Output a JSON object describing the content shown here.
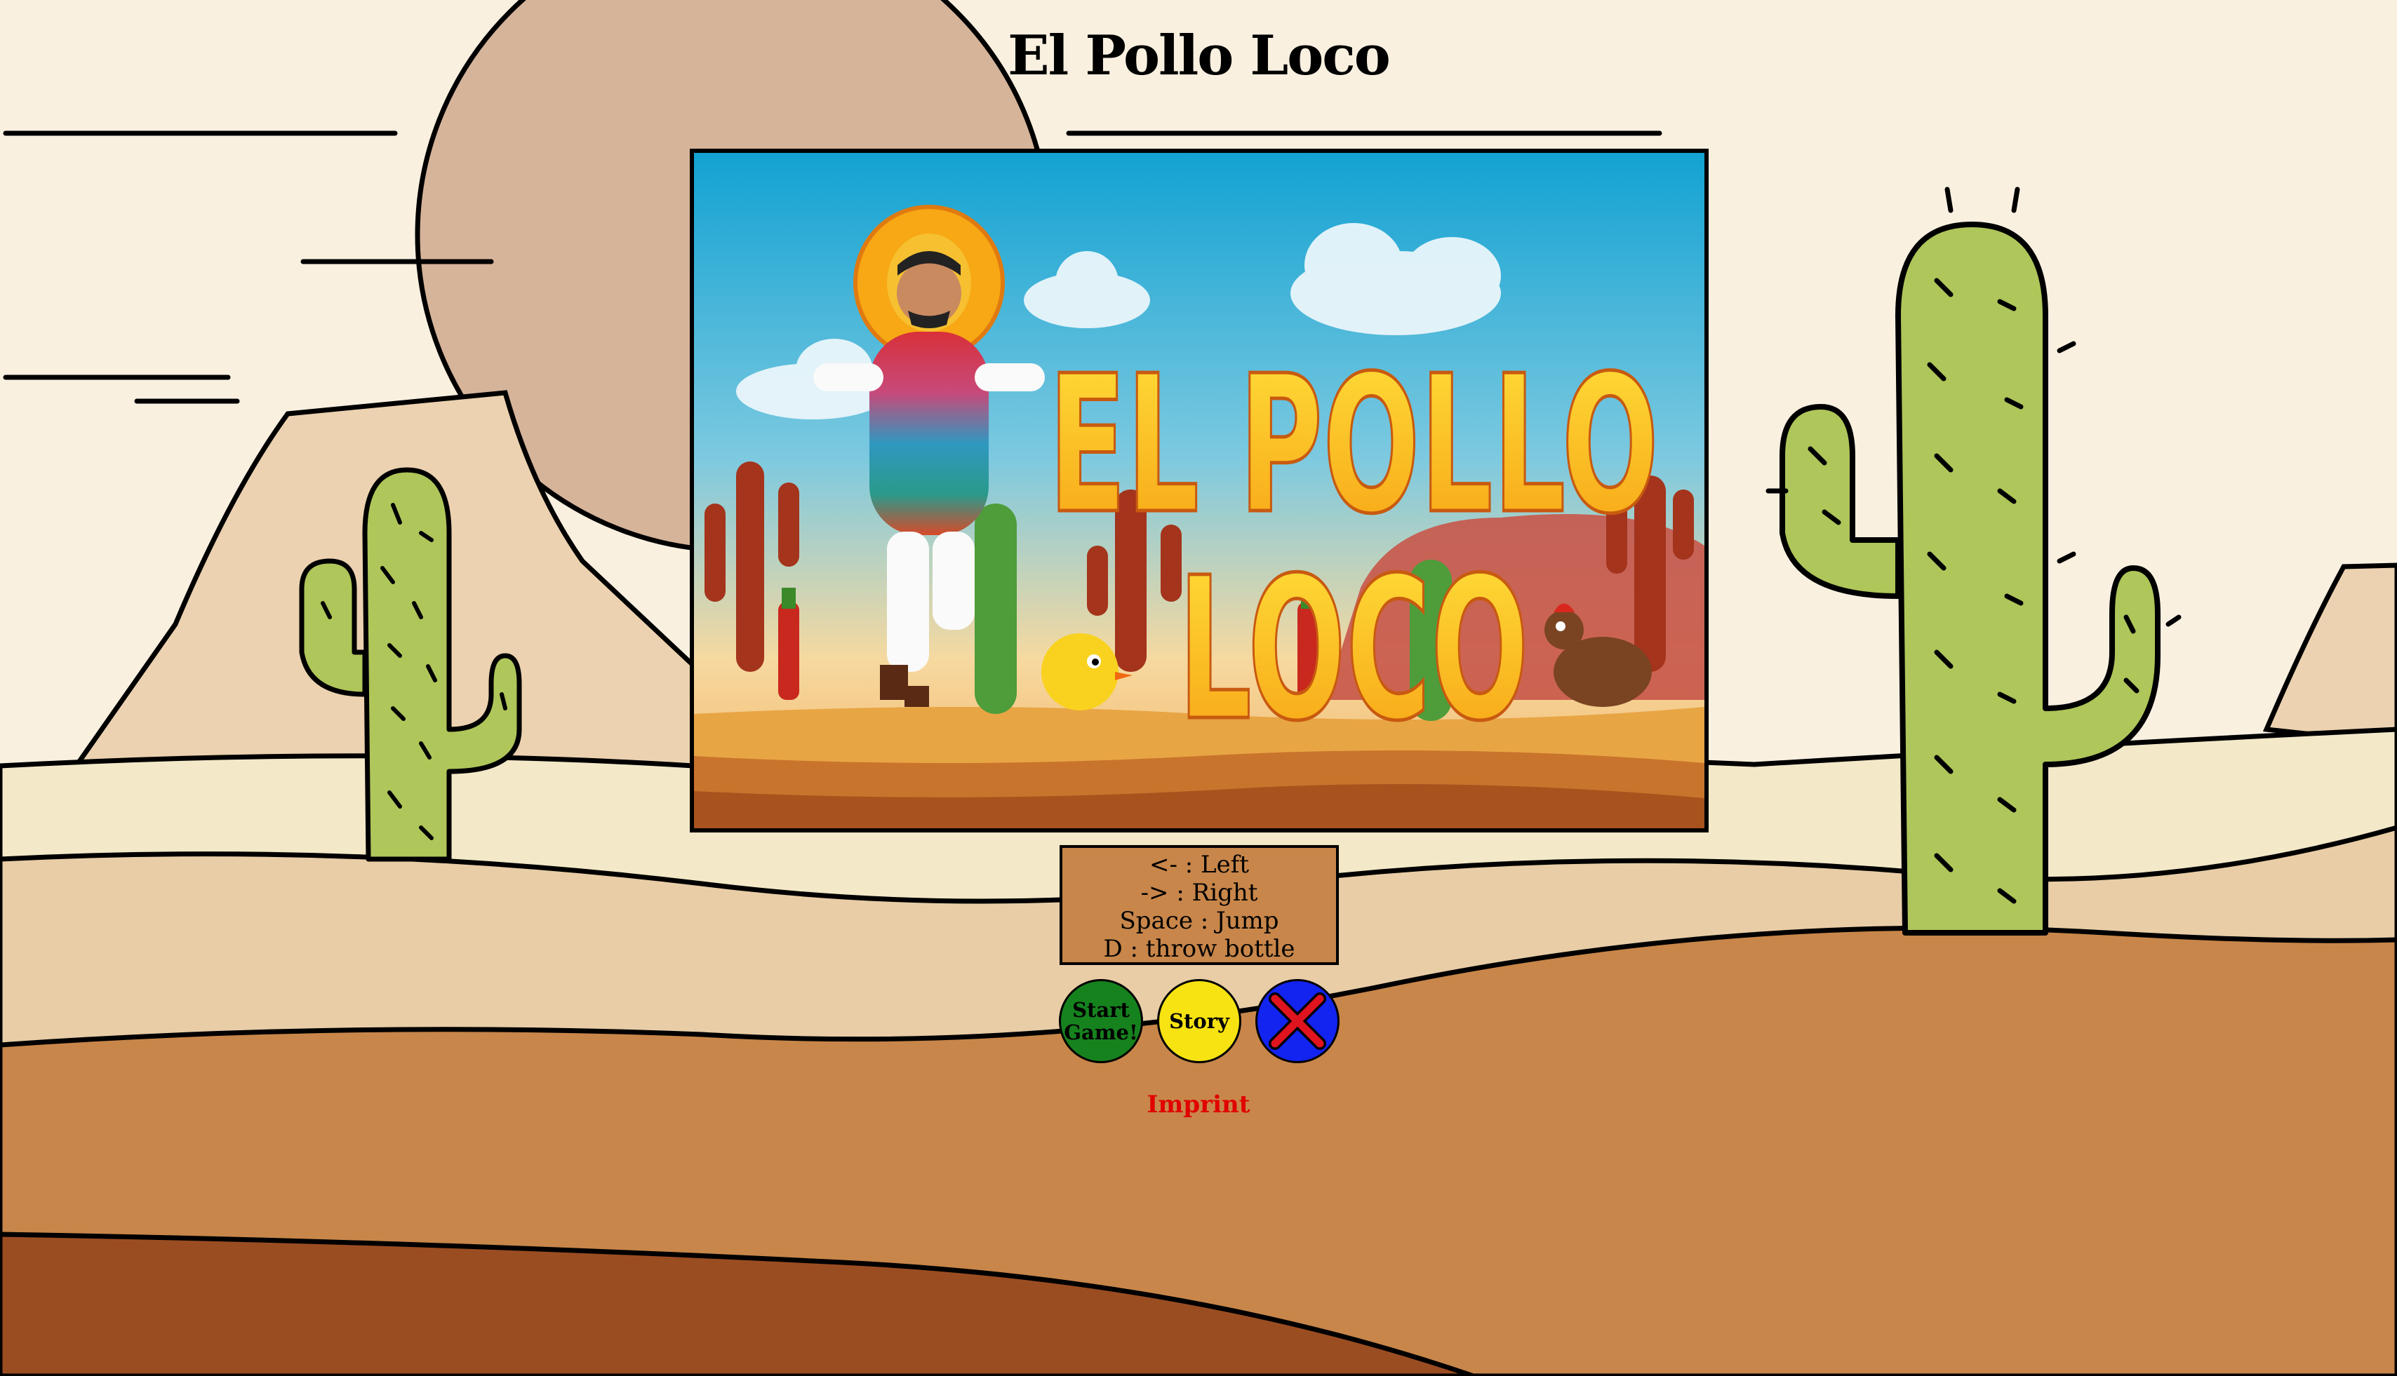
{
  "page": {
    "title": "El Pollo Loco"
  },
  "canvas": {
    "logo_line1": "EL POLLO",
    "logo_line2": "LOCO"
  },
  "controls": {
    "lines": [
      "<- : Left",
      "-> : Right",
      "Space : Jump",
      "D : throw bottle"
    ]
  },
  "buttons": {
    "start_label_line1": "Start",
    "start_label_line2": "Game!",
    "story_label": "Story",
    "close_icon": "close-x-icon"
  },
  "footer": {
    "imprint_label": "Imprint"
  },
  "colors": {
    "start_button": "#16821e",
    "story_button": "#f7e212",
    "close_button": "#1323f0",
    "close_x": "#e0141e",
    "imprint": "#e10000",
    "controls_bg": "#c8864a",
    "page_bg": "#f9f0e0"
  }
}
